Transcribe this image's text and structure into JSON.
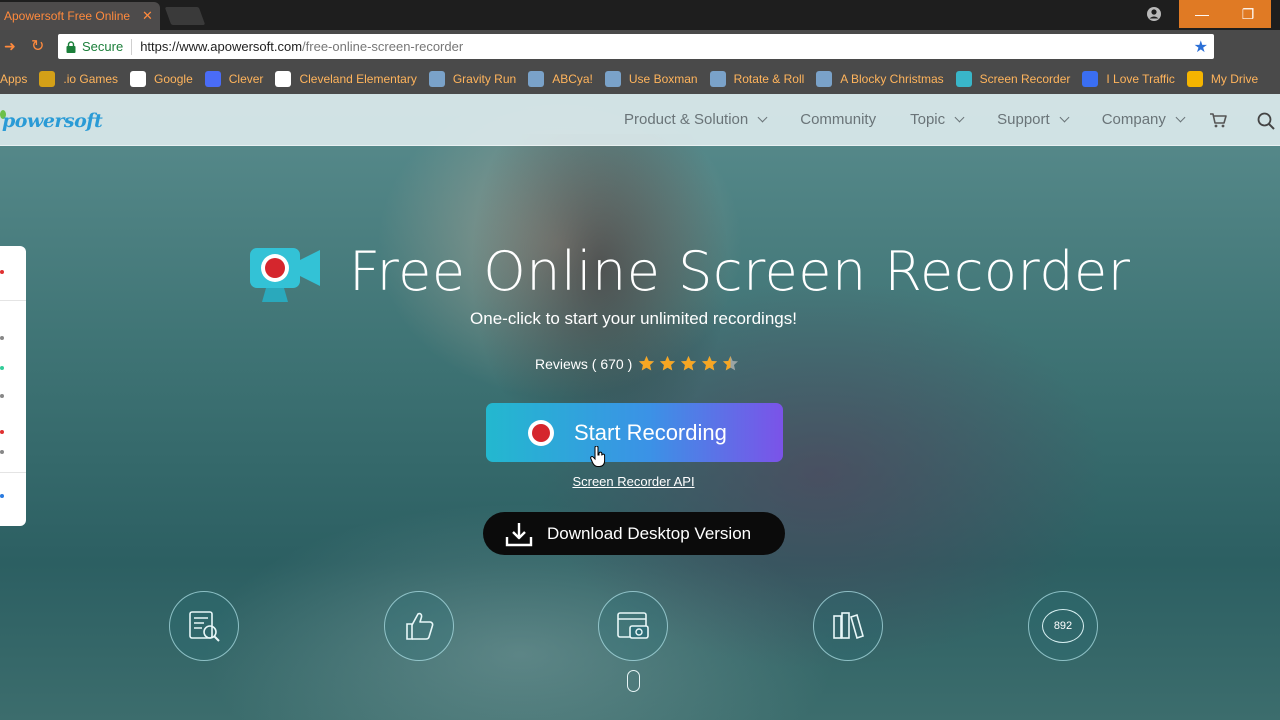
{
  "browser": {
    "tab_title": "Apowersoft Free Online Sc",
    "secure_label": "Secure",
    "url_host": "https://www.apowersoft.com",
    "url_path": "/free-online-screen-recorder",
    "accent_color": "#ff8a3d"
  },
  "bookmarks": [
    {
      "label": "Apps",
      "icon": "apps-grid-icon",
      "color": "#3b82f6"
    },
    {
      "label": ".io Games",
      "icon": "io-games-icon",
      "color": "#d4a017"
    },
    {
      "label": "Google",
      "icon": "google-icon",
      "color": "#ffffff"
    },
    {
      "label": "Clever",
      "icon": "clever-icon",
      "color": "#4a6cf7"
    },
    {
      "label": "Cleveland Elementary",
      "icon": "school-icon",
      "color": "#ffffff"
    },
    {
      "label": "Gravity Run",
      "icon": "game-icon",
      "color": "#7aa2c9"
    },
    {
      "label": "ABCya!",
      "icon": "game-icon",
      "color": "#7aa2c9"
    },
    {
      "label": "Use Boxman",
      "icon": "game-icon",
      "color": "#7aa2c9"
    },
    {
      "label": "Rotate & Roll",
      "icon": "game-icon",
      "color": "#7aa2c9"
    },
    {
      "label": "A Blocky Christmas",
      "icon": "game-icon",
      "color": "#7aa2c9"
    },
    {
      "label": "Screen Recorder",
      "icon": "screen-recorder-icon",
      "color": "#39b6c9"
    },
    {
      "label": "I Love Traffic",
      "icon": "traffic-icon",
      "color": "#3a6ef2"
    },
    {
      "label": "My Drive",
      "icon": "google-drive-icon",
      "color": "#f4b400"
    }
  ],
  "site": {
    "logo_text": "powersoft",
    "nav": [
      {
        "label": "Product & Solution",
        "dropdown": true
      },
      {
        "label": "Community",
        "dropdown": false
      },
      {
        "label": "Topic",
        "dropdown": true
      },
      {
        "label": "Support",
        "dropdown": true
      },
      {
        "label": "Company",
        "dropdown": true
      }
    ]
  },
  "hero": {
    "title": "Free Online Screen Recorder",
    "subtitle": "One-click to start your unlimited recordings!",
    "reviews_label": "Reviews ( 670 )",
    "rating": 4.5,
    "rating_max": 5,
    "start_button": "Start Recording",
    "api_link": "Screen Recorder API",
    "download_button": "Download Desktop Version",
    "button_gradient": [
      "#23b8cf",
      "#3b92e6",
      "#7b53e8"
    ],
    "record_color": "#d5262d"
  },
  "features": [
    {
      "icon": "document-search-icon"
    },
    {
      "icon": "thumbs-up-icon"
    },
    {
      "icon": "screen-camera-icon"
    },
    {
      "icon": "books-icon"
    },
    {
      "icon": "comment-count-icon",
      "count": "892"
    }
  ]
}
